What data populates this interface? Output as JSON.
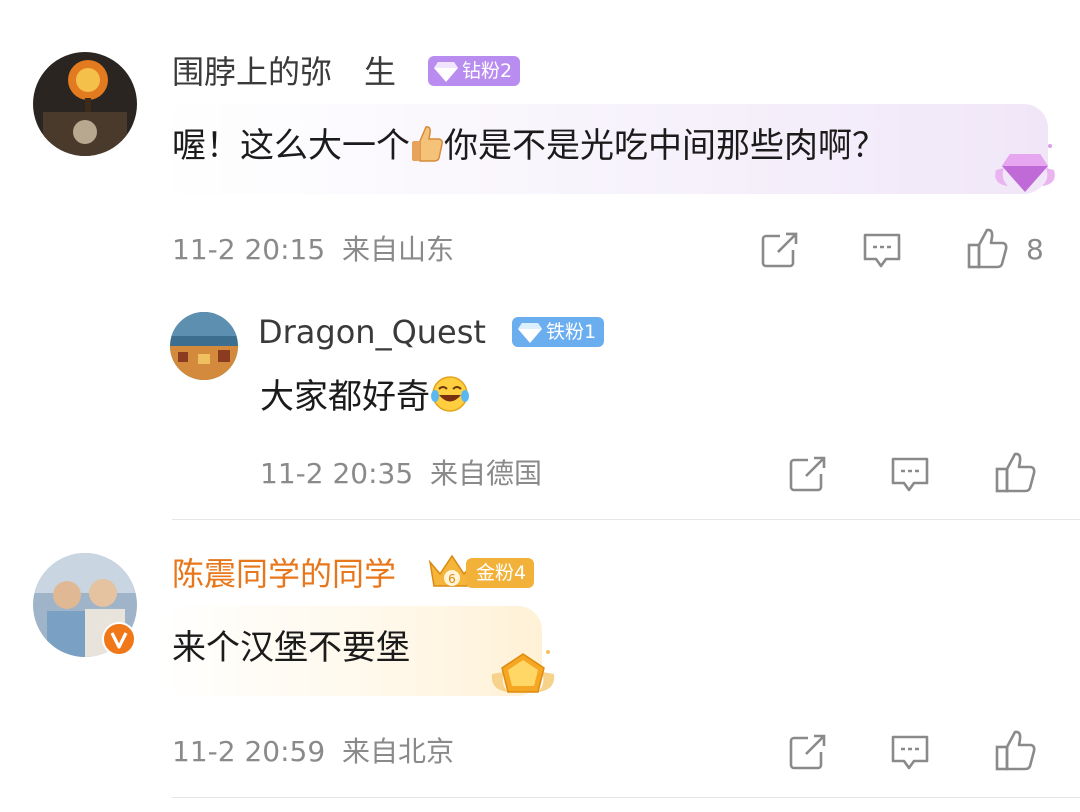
{
  "comments": [
    {
      "username": "围脖上的弥　生",
      "badge": "钻粉2",
      "text_part1": "喔！这么大一个",
      "text_part2": "你是不是光吃中间那些肉啊？",
      "time": "11-2 20:15",
      "location": "来自山东",
      "like_count": "8",
      "icons": [
        "share-icon",
        "comment-icon",
        "like-icon"
      ]
    },
    {
      "username": "Dragon_Quest",
      "badge": "铁粉1",
      "text": "大家都好奇",
      "time": "11-2 20:35",
      "location": "来自德国",
      "icons": [
        "share-icon",
        "comment-icon",
        "like-icon"
      ]
    },
    {
      "username": "陈震同学的同学",
      "badge": "金粉4",
      "text": "来个汉堡不要堡",
      "time": "11-2 20:59",
      "location": "来自北京",
      "icons": [
        "share-icon",
        "comment-icon",
        "like-icon"
      ]
    }
  ],
  "colors": {
    "diamond_badge": "#b98df0",
    "iron_badge": "#6aaef0",
    "gold_badge": "#f2b23a",
    "gold_name": "#e8761a",
    "meta_gray": "#8a8a8a"
  }
}
